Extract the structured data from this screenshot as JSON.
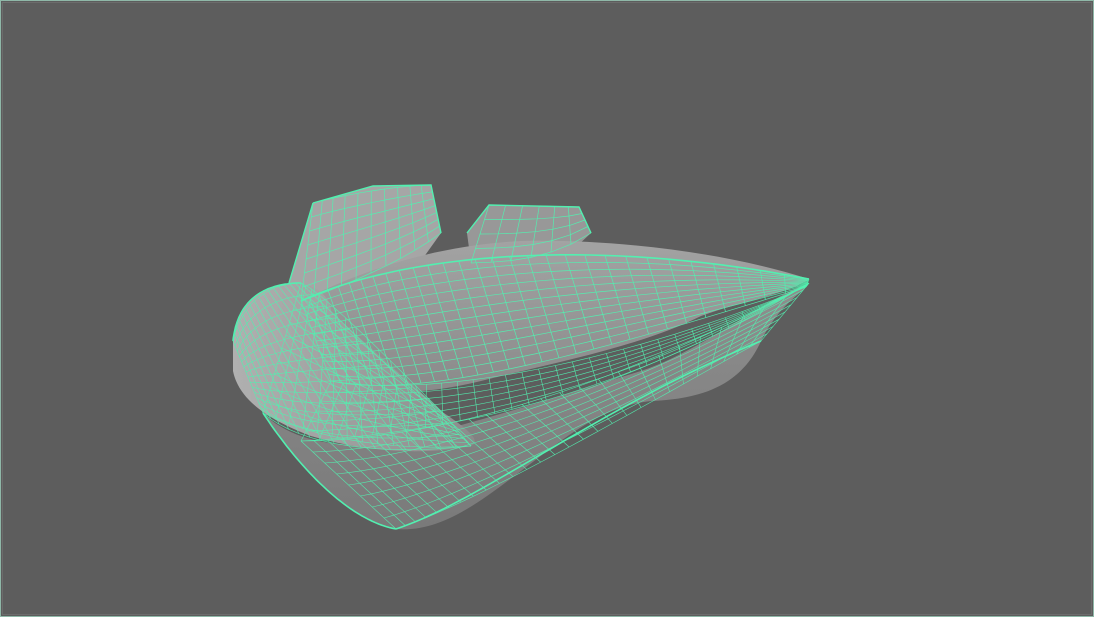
{
  "viewport": {
    "background_color": "#5d5d5d",
    "frame_color": "#8fb8a8"
  },
  "model": {
    "render_mode": "wireframe-on-shaded",
    "wire_color": "#52f0b0",
    "wire_color_dense": "#3fe0a0",
    "shade_color": "#9a9a9a",
    "shade_color_dark": "#7e7e7e",
    "shade_color_light": "#b2b2b2",
    "selected": true
  }
}
